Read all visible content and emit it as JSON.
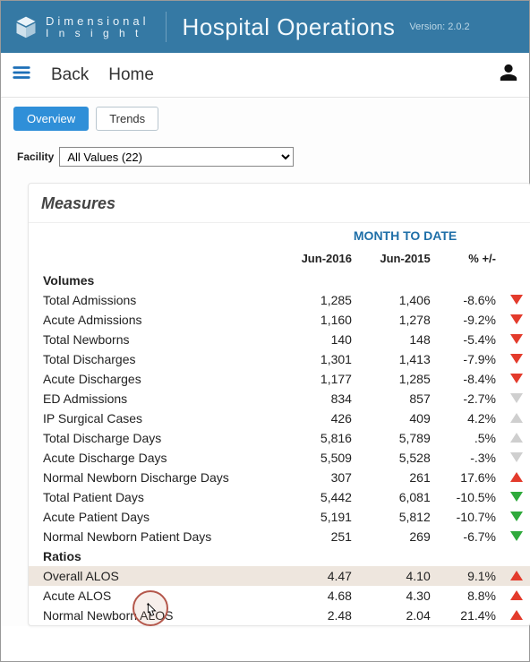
{
  "brand": {
    "name_line1": "Dimensional",
    "name_line2": "I n s i g h t",
    "app_title": "Hospital Operations",
    "version_label": "Version: 2.0.2"
  },
  "toolbar": {
    "back": "Back",
    "home": "Home"
  },
  "tabs": {
    "overview": "Overview",
    "trends": "Trends"
  },
  "filter": {
    "label": "Facility",
    "value": "All Values (22)"
  },
  "card": {
    "title": "Measures",
    "group_header": "MONTH TO DATE",
    "columns": {
      "c1": "",
      "c2": "Jun-2016",
      "c3": "Jun-2015",
      "c4": "% +/-"
    }
  },
  "sections": [
    {
      "name": "Volumes",
      "rows": [
        {
          "label": "Total Admissions",
          "a": "1,285",
          "b": "1,406",
          "pct": "-8.6%",
          "ind": "down-red"
        },
        {
          "label": "Acute Admissions",
          "a": "1,160",
          "b": "1,278",
          "pct": "-9.2%",
          "ind": "down-red"
        },
        {
          "label": "Total Newborns",
          "a": "140",
          "b": "148",
          "pct": "-5.4%",
          "ind": "down-red"
        },
        {
          "label": "Total Discharges",
          "a": "1,301",
          "b": "1,413",
          "pct": "-7.9%",
          "ind": "down-red"
        },
        {
          "label": "Acute Discharges",
          "a": "1,177",
          "b": "1,285",
          "pct": "-8.4%",
          "ind": "down-red"
        },
        {
          "label": "ED Admissions",
          "a": "834",
          "b": "857",
          "pct": "-2.7%",
          "ind": "down-grey"
        },
        {
          "label": "IP Surgical Cases",
          "a": "426",
          "b": "409",
          "pct": "4.2%",
          "ind": "up-grey"
        },
        {
          "label": "Total Discharge Days",
          "a": "5,816",
          "b": "5,789",
          "pct": ".5%",
          "ind": "up-grey"
        },
        {
          "label": "Acute Discharge Days",
          "a": "5,509",
          "b": "5,528",
          "pct": "-.3%",
          "ind": "down-grey"
        },
        {
          "label": "Normal Newborn Discharge Days",
          "a": "307",
          "b": "261",
          "pct": "17.6%",
          "ind": "up-red"
        },
        {
          "label": "Total Patient Days",
          "a": "5,442",
          "b": "6,081",
          "pct": "-10.5%",
          "ind": "down-green"
        },
        {
          "label": "Acute Patient Days",
          "a": "5,191",
          "b": "5,812",
          "pct": "-10.7%",
          "ind": "down-green"
        },
        {
          "label": "Normal Newborn Patient Days",
          "a": "251",
          "b": "269",
          "pct": "-6.7%",
          "ind": "down-green"
        }
      ]
    },
    {
      "name": "Ratios",
      "rows": [
        {
          "label": "Overall ALOS",
          "a": "4.47",
          "b": "4.10",
          "pct": "9.1%",
          "ind": "up-red",
          "highlight": true
        },
        {
          "label": "Acute ALOS",
          "a": "4.68",
          "b": "4.30",
          "pct": "8.8%",
          "ind": "up-red"
        },
        {
          "label": "Normal Newborn ALOS",
          "a": "2.48",
          "b": "2.04",
          "pct": "21.4%",
          "ind": "up-red"
        }
      ]
    }
  ]
}
